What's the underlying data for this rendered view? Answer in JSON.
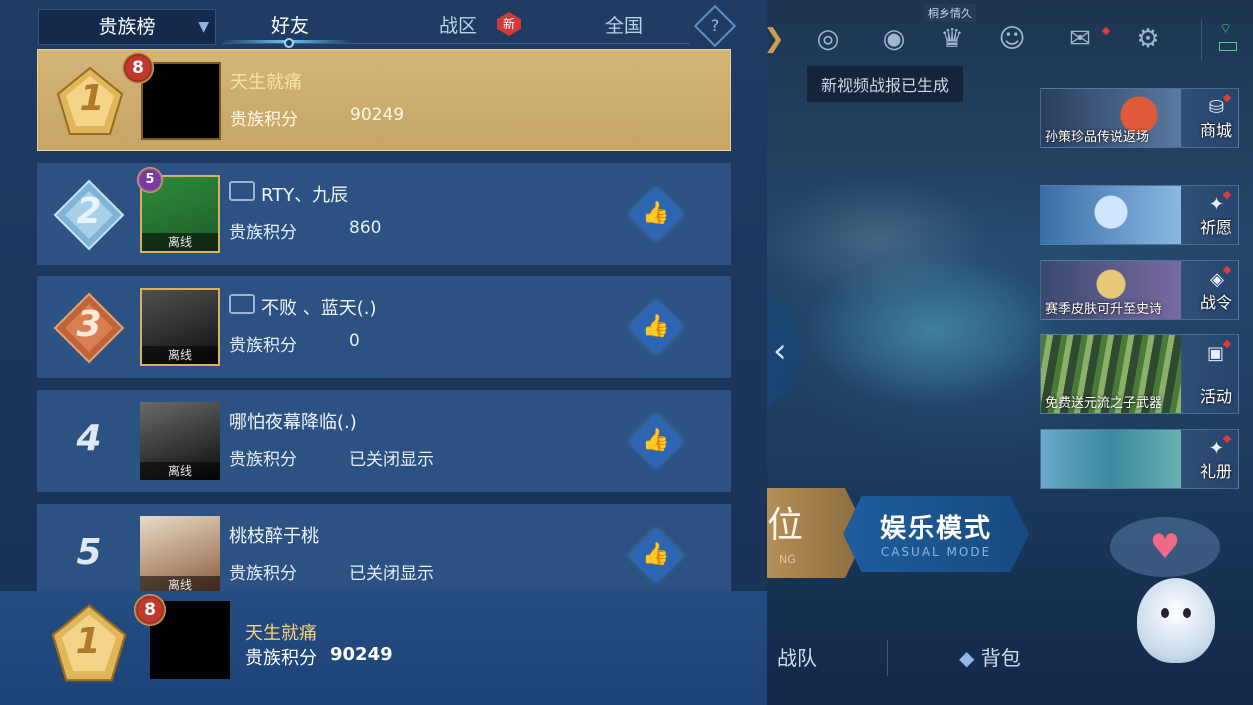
{
  "header": {
    "filter_label": "贵族榜",
    "tabs": [
      {
        "label": "好友",
        "active": true
      },
      {
        "label": "战区",
        "badge": "新"
      },
      {
        "label": "全国"
      }
    ],
    "help_symbol": "?"
  },
  "score_label": "贵族积分",
  "leaderboard": [
    {
      "rank": 1,
      "name": "天生就痛",
      "level": 8,
      "score": "90249",
      "is_self": true
    },
    {
      "rank": 2,
      "name": "RTY、九辰",
      "level": 5,
      "score": "860",
      "status": "离线"
    },
    {
      "rank": 3,
      "name": "不败 、蓝天(.)",
      "score": "0",
      "status": "离线"
    },
    {
      "rank": 4,
      "name": "哪怕夜幕降临(.)",
      "score": "已关闭显示",
      "status": "离线"
    },
    {
      "rank": 5,
      "name": "桃枝醉于桃",
      "score": "已关闭显示",
      "status": "离线"
    }
  ],
  "my_entry": {
    "rank": 1,
    "level": 8,
    "name": "天生就痛",
    "score_label": "贵族积分",
    "score": "90249"
  },
  "scene": {
    "eye_label": "桐乡情久",
    "tooltip": "新视频战报已生成",
    "promos": [
      {
        "text": "孙策珍品传说返场",
        "label": "商城"
      },
      {
        "text": "",
        "label": "祈愿"
      },
      {
        "text": "赛季皮肤可升至史诗",
        "label": "战令"
      },
      {
        "text": "免费送元流之子武器",
        "label": "活动"
      },
      {
        "text": "",
        "label": "礼册"
      }
    ],
    "mode_left": "位",
    "mode_left_sub": "NG",
    "mode_casual": "娱乐模式",
    "mode_casual_sub": "CASUAL MODE",
    "bottom_buttons": [
      "战队",
      "背包"
    ]
  },
  "icons": [
    "target-icon",
    "eye-icon",
    "trophy-icon",
    "friends-icon",
    "mail-icon",
    "gear-icon",
    "wifi-icon",
    "battery-icon",
    "thumbs-up-icon"
  ],
  "colors": {
    "accent": "#6cc4ff",
    "self_row": "#c6a565",
    "row": "#2b5283",
    "badge": "#d23a3a"
  }
}
